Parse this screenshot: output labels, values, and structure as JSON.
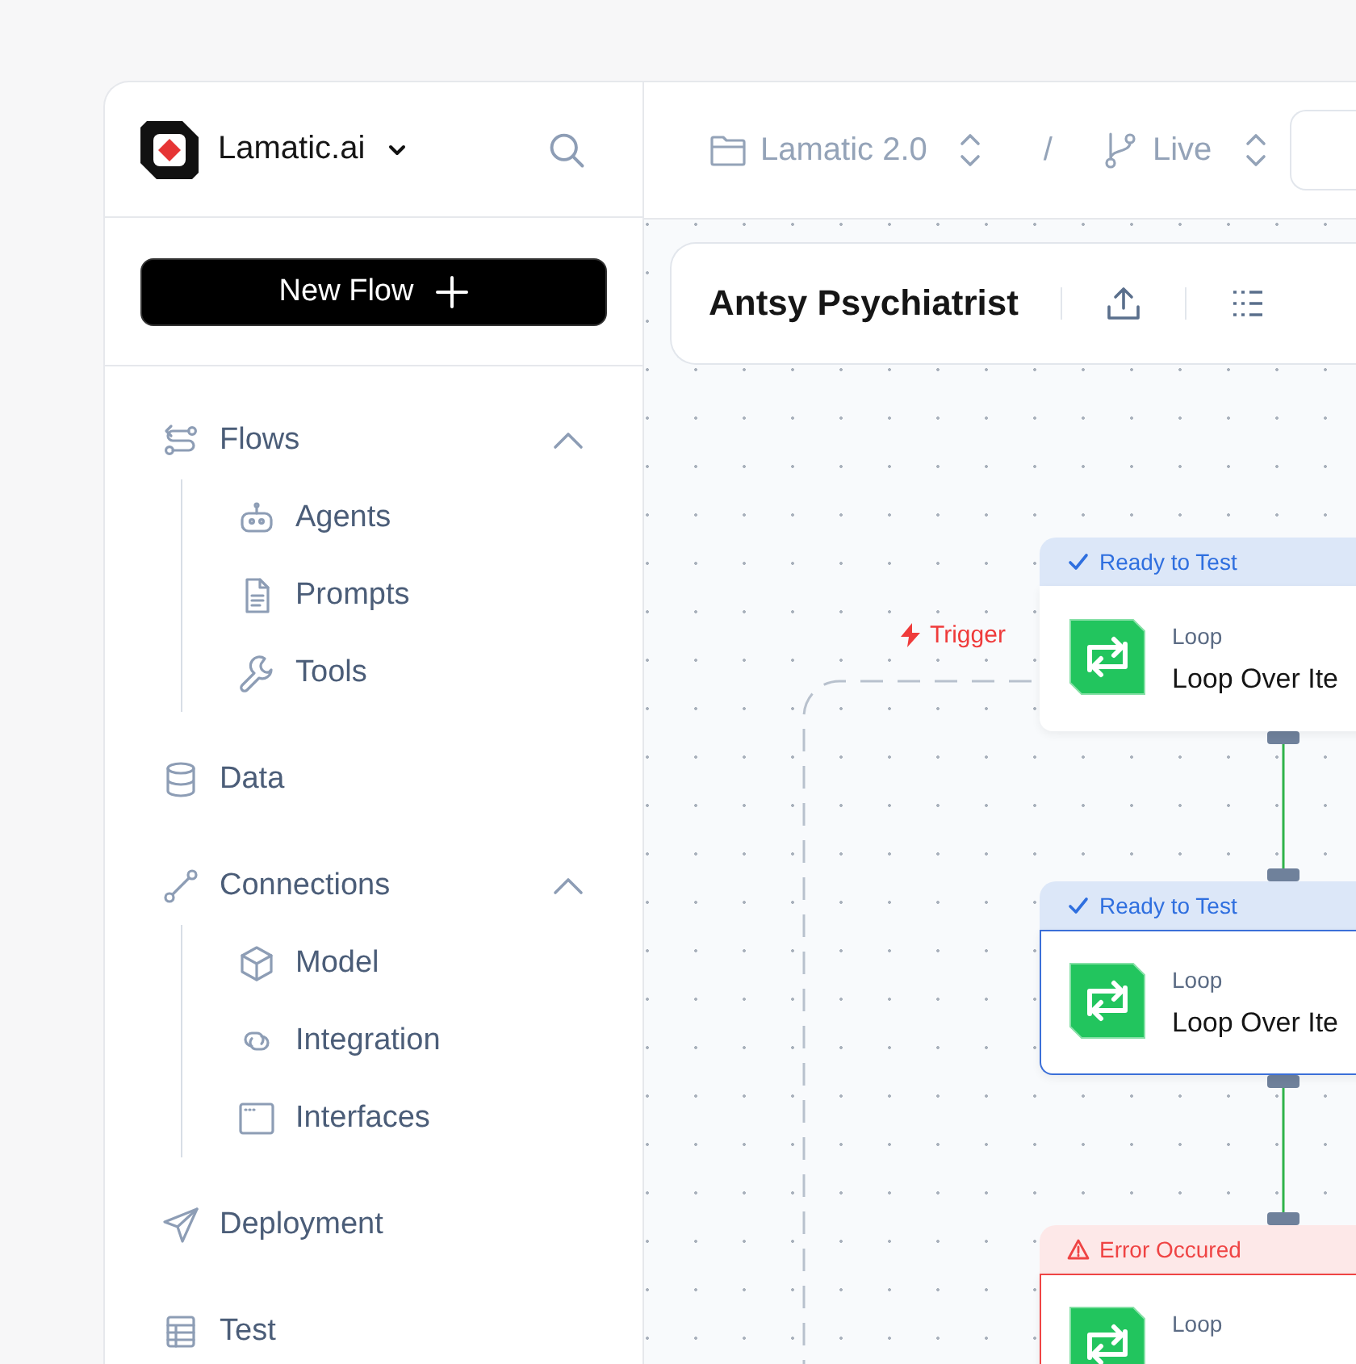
{
  "workspace": {
    "name": "Lamatic.ai"
  },
  "new_flow_button": {
    "label": "New Flow"
  },
  "sidebar": {
    "items": [
      {
        "label": "Flows",
        "expanded": true,
        "children": [
          {
            "label": "Agents"
          },
          {
            "label": "Prompts"
          },
          {
            "label": "Tools"
          }
        ]
      },
      {
        "label": "Data"
      },
      {
        "label": "Connections",
        "expanded": true,
        "children": [
          {
            "label": "Model"
          },
          {
            "label": "Integration"
          },
          {
            "label": "Interfaces"
          }
        ]
      },
      {
        "label": "Deployment"
      },
      {
        "label": "Test"
      }
    ]
  },
  "breadcrumb": {
    "project": "Lamatic 2.0",
    "separator": "/",
    "branch": "Live"
  },
  "flow": {
    "title": "Antsy Psychiatrist"
  },
  "trigger": {
    "label": "Trigger"
  },
  "nodes": [
    {
      "kind": "ready",
      "status_text": "Ready to Test",
      "selected": false,
      "type": "Loop",
      "title": "Loop Over Ite"
    },
    {
      "kind": "ready",
      "status_text": "Ready to Test",
      "selected": true,
      "type": "Loop",
      "title": "Loop Over Ite"
    },
    {
      "kind": "error",
      "status_text": "Error Occured",
      "selected": false,
      "type": "Loop"
    }
  ]
}
